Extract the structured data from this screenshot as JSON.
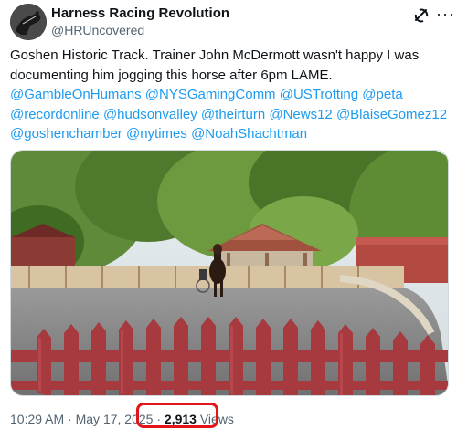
{
  "author": {
    "name": "Harness Racing Revolution",
    "handle": "@HRUncovered"
  },
  "header_icons": [
    "grok-icon",
    "more-icon"
  ],
  "tweet": {
    "line1": "Goshen Historic Track. Trainer John McDermott wasn't happy I was",
    "line2": "documenting him jogging this horse after 6pm LAME.",
    "mentions_line1": [
      "@GambleOnHumans",
      "@NYSGamingComm",
      "@USTrotting",
      "@peta"
    ],
    "mentions_line2": [
      "@recordonline",
      "@hudsonvalley",
      "@theirturn",
      "@News12",
      "@BlaiseGomez12"
    ],
    "mentions_line3": [
      "@goshenchamber",
      "@nytimes",
      "@NoahShachtman"
    ]
  },
  "meta": {
    "time": "10:29 AM",
    "separator": "·",
    "date": "May 17, 2025",
    "views_count": "2,913",
    "views_label": "Views"
  },
  "colors": {
    "mention": "#1d9bf0",
    "highlight": "#e0161c",
    "secondary_text": "#536471"
  }
}
